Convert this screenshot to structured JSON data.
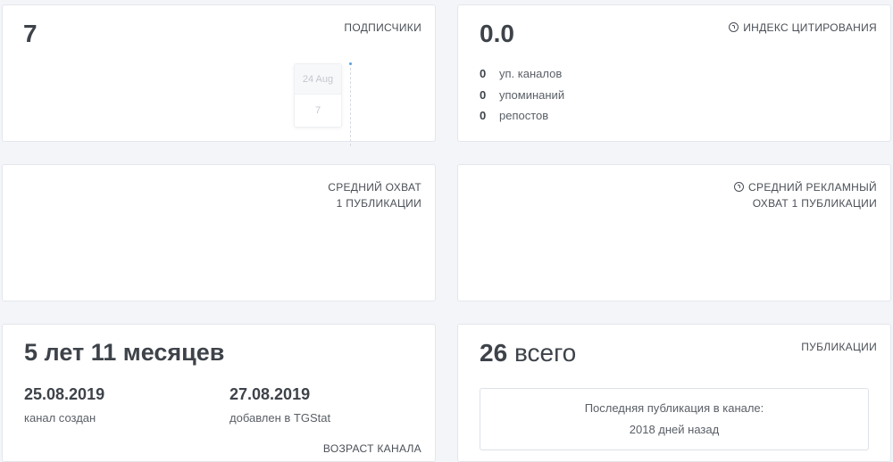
{
  "subscribers": {
    "value": "7",
    "label": "ПОДПИСЧИКИ",
    "tooltip_date": "24 Aug",
    "tooltip_value": "7"
  },
  "citation": {
    "value": "0.0",
    "label": "ИНДЕКС ЦИТИРОВАНИЯ",
    "icon": "help-circle-icon",
    "rows": [
      {
        "num": "0",
        "text": "уп. каналов"
      },
      {
        "num": "0",
        "text": "упоминаний"
      },
      {
        "num": "0",
        "text": "репостов"
      }
    ]
  },
  "avg_reach": {
    "label_line1": "СРЕДНИЙ ОХВАТ",
    "label_line2": "1 ПУБЛИКАЦИИ"
  },
  "avg_ad_reach": {
    "label_line1": "СРЕДНИЙ РЕКЛАМНЫЙ",
    "label_line2": "ОХВАТ 1 ПУБЛИКАЦИИ",
    "icon": "help-circle-icon"
  },
  "channel_age": {
    "value": "5 лет 11 месяцев",
    "created_date": "25.08.2019",
    "created_caption": "канал создан",
    "added_date": "27.08.2019",
    "added_caption": "добавлен в TGStat",
    "label": "ВОЗРАСТ КАНАЛА"
  },
  "publications": {
    "count": "26",
    "count_suffix": "всего",
    "label": "ПУБЛИКАЦИИ",
    "last_pub_line1": "Последняя публикация в канале:",
    "last_pub_line2": "2018 дней назад"
  }
}
